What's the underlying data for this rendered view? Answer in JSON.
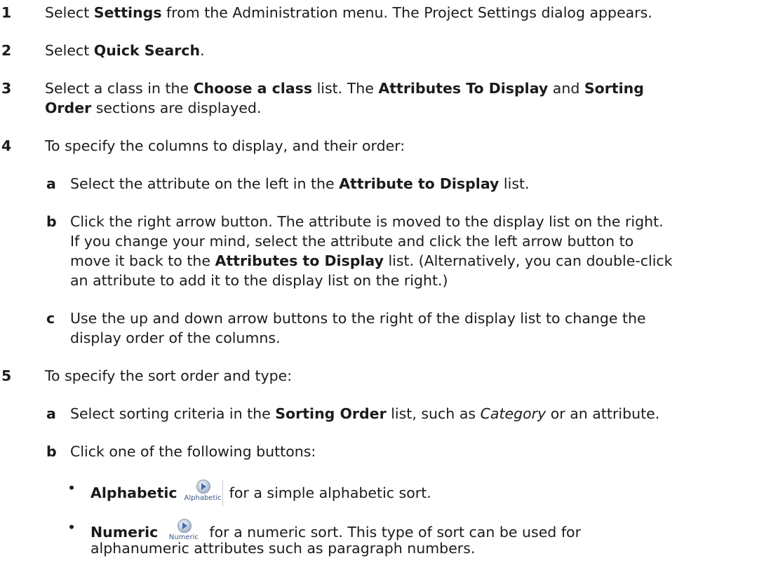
{
  "steps": {
    "s1": {
      "num": "1",
      "a": "Select ",
      "b": "Settings",
      "c": " from the Administration menu. The Project Settings dialog appears."
    },
    "s2": {
      "num": "2",
      "a": "Select ",
      "b": "Quick Search",
      "c": "."
    },
    "s3": {
      "num": "3",
      "a": "Select a class in the ",
      "b": "Choose a class",
      "c": " list. The ",
      "d": "Attributes To Display",
      "e": " and ",
      "f": "Sorting",
      "g": "Order",
      "h": " sections are displayed."
    },
    "s4": {
      "num": "4",
      "intro": "To specify the columns to display, and their order:",
      "a": {
        "letter": "a",
        "t1": "Select the attribute on the left in the ",
        "b1": "Attribute to Display",
        "t2": " list."
      },
      "b": {
        "letter": "b",
        "l1": "Click the right arrow button. The attribute is moved to the display list on the right.",
        "l2": "If you change your mind, select the attribute and click the left arrow button to",
        "l3a": "move it back to the ",
        "l3b": "Attributes to Display",
        "l3c": " list. (Alternatively, you can double-click",
        "l4": "an attribute to add it to the display list on the right.)"
      },
      "c": {
        "letter": "c",
        "l1": "Use the up and down arrow buttons to the right of the display list to change the",
        "l2": "display order of the columns."
      }
    },
    "s5": {
      "num": "5",
      "intro": "To specify the sort order and type:",
      "a": {
        "letter": "a",
        "t1": "Select sorting criteria in the ",
        "b1": "Sorting Order",
        "t2": " list, such as ",
        "i1": "Category",
        "t3": " or an attribute."
      },
      "b": {
        "letter": "b",
        "text": "Click one of the following buttons:"
      },
      "bullets": [
        {
          "symbol": "•",
          "name": "Alphabetic",
          "icon": "arrow-orb-icon",
          "icon_caption": "Alphabetic",
          "rest": " for a simple alphabetic sort."
        },
        {
          "symbol": "•",
          "name": "Numeric",
          "icon": "arrow-orb-icon",
          "icon_caption": "Numeric",
          "rest": " for a numeric sort. This type of sort can be used for",
          "rest2": "alphanumeric attributes such as paragraph numbers."
        }
      ]
    }
  }
}
